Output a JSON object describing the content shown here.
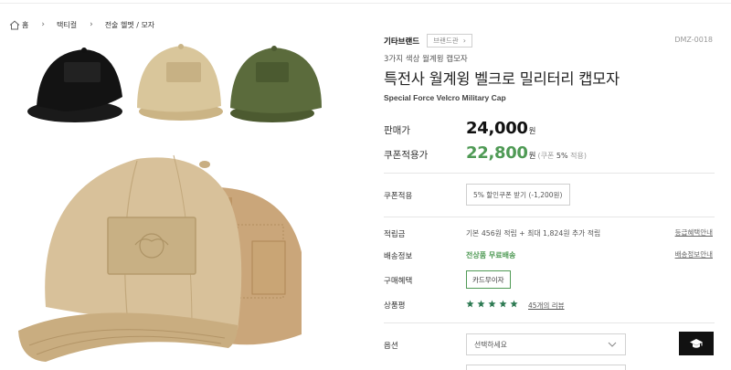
{
  "breadcrumb": {
    "home": "홈",
    "items": [
      "택티컬",
      "전술 헬멧 / 모자"
    ]
  },
  "product": {
    "brand": "기타브랜드",
    "brand_shop_label": "브랜드관",
    "code": "DMZ-0018",
    "subtitle": "3가지 색상 월계윙 캡모자",
    "title": "특전사 월계윙 벨크로 밀리터리 캡모자",
    "en_title": "Special Force Velcro Military Cap",
    "colors": [
      "#111111",
      "#d8c59a",
      "#5b6b3c"
    ]
  },
  "pricing": {
    "sale_label": "판매가",
    "sale_price": "24,000",
    "unit": "원",
    "coupon_label": "쿠폰적용가",
    "coupon_price": "22,800",
    "coupon_note_prefix": "(쿠폰",
    "coupon_note_pct": "5%",
    "coupon_note_suffix": "적용)"
  },
  "coupon": {
    "label": "쿠폰적용",
    "button": "5% 할인쿠폰 받기 (-1,200원)"
  },
  "details": {
    "points_label": "적립금",
    "points_text": "기본 456원 적립 + 최대 1,824원 추가 적립",
    "points_link": "등급혜택안내",
    "shipping_label": "배송정보",
    "shipping_text": "전상품 무료배송",
    "shipping_link": "배송정보안내",
    "benefit_label": "구매혜택",
    "benefit_badge": "카드무이자",
    "review_label": "상품평",
    "rating": 5,
    "review_link": "45개의 리뷰"
  },
  "options": {
    "label": "옵션",
    "placeholder": "선택하세요"
  },
  "floating_button": {
    "icon": "graduation-cap-icon"
  }
}
